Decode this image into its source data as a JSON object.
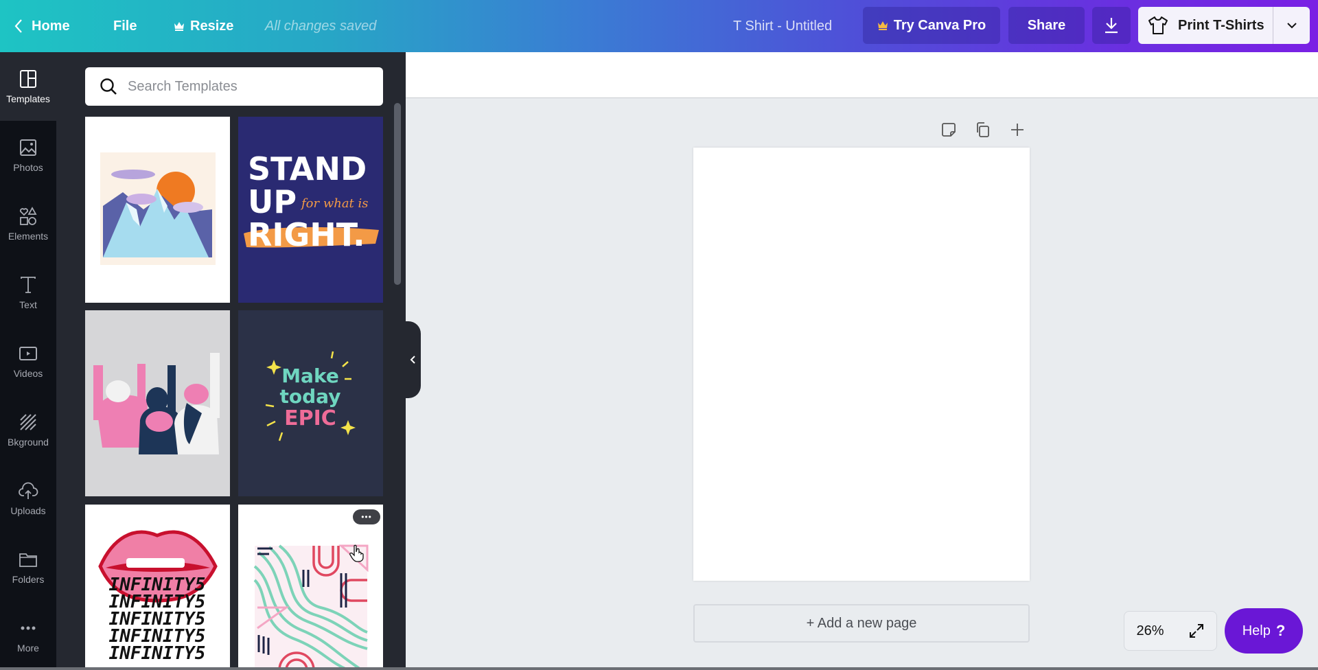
{
  "topbar": {
    "home_label": "Home",
    "file_label": "File",
    "resize_label": "Resize",
    "save_status": "All changes saved",
    "doc_title": "T Shirt - Untitled",
    "try_pro_label": "Try Canva Pro",
    "share_label": "Share",
    "print_label": "Print T-Shirts",
    "crown_color": "#f5b942"
  },
  "rail": {
    "items": [
      {
        "label": "Templates",
        "icon": "templates-icon",
        "active": true
      },
      {
        "label": "Photos",
        "icon": "photos-icon"
      },
      {
        "label": "Elements",
        "icon": "elements-icon"
      },
      {
        "label": "Text",
        "icon": "text-icon"
      },
      {
        "label": "Videos",
        "icon": "videos-icon"
      },
      {
        "label": "Bkground",
        "icon": "background-icon"
      },
      {
        "label": "Uploads",
        "icon": "uploads-icon"
      },
      {
        "label": "Folders",
        "icon": "folders-icon"
      },
      {
        "label": "More",
        "icon": "more-icon"
      }
    ]
  },
  "templates_panel": {
    "search_placeholder": "Search Templates",
    "thumbnails": [
      {
        "name": "mountain-sun-template"
      },
      {
        "name": "stand-up-template",
        "line1": "STAND",
        "line2": "UP",
        "script": "for what is",
        "line3": "RIGHT."
      },
      {
        "name": "friends-peace-template"
      },
      {
        "name": "make-today-epic-template",
        "line1": "Make",
        "line2": "today",
        "line3": "EPIC"
      },
      {
        "name": "infinity-lips-template",
        "repeat_text": "INFINITY5"
      },
      {
        "name": "abstract-lines-template",
        "more_label": "•••"
      }
    ]
  },
  "canvas": {
    "add_page_label": "+ Add a new page",
    "zoom_level": "26%",
    "help_label": "Help",
    "help_icon": "?"
  },
  "colors": {
    "accent_purple": "#6a17d6",
    "rail_bg": "#0e1117",
    "panel_bg": "#252830",
    "canvas_bg": "#e9ecef"
  }
}
